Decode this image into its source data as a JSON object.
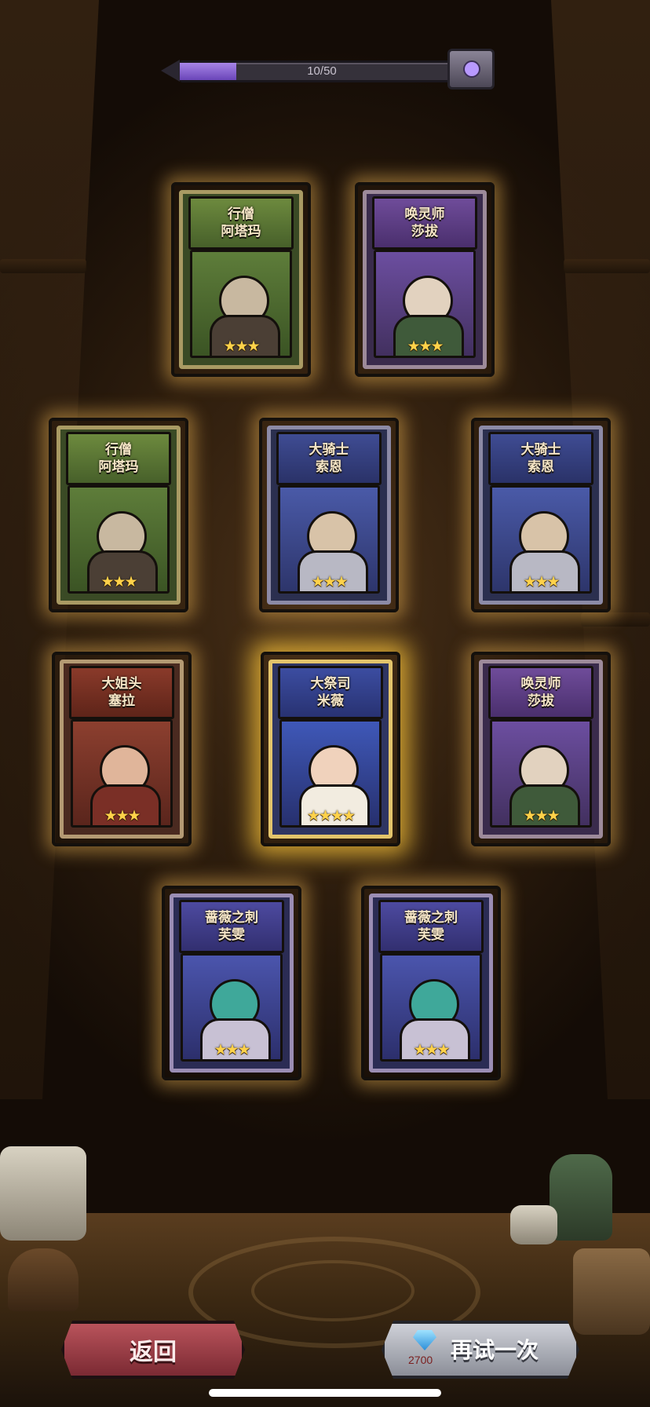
{
  "progress": {
    "label": "10/50",
    "value": 10,
    "max": 50
  },
  "cards": [
    {
      "title1": "行僧",
      "title2": "阿塔玛",
      "stars": "★★★",
      "theme": "green"
    },
    {
      "title1": "唤灵师",
      "title2": "莎拔",
      "stars": "★★★",
      "theme": "purple"
    },
    {
      "title1": "行僧",
      "title2": "阿塔玛",
      "stars": "★★★",
      "theme": "green"
    },
    {
      "title1": "大骑士",
      "title2": "索恩",
      "stars": "★★★",
      "theme": "blue"
    },
    {
      "title1": "大骑士",
      "title2": "索恩",
      "stars": "★★★",
      "theme": "blue"
    },
    {
      "title1": "大姐头",
      "title2": "塞拉",
      "stars": "★★★",
      "theme": "red"
    },
    {
      "title1": "大祭司",
      "title2": "米薇",
      "stars": "★★★★",
      "theme": "gold"
    },
    {
      "title1": "唤灵师",
      "title2": "莎拔",
      "stars": "★★★",
      "theme": "purple"
    },
    {
      "title1": "蔷薇之刺",
      "title2": "芙雯",
      "stars": "★★★",
      "theme": "teal"
    },
    {
      "title1": "蔷薇之刺",
      "title2": "芙雯",
      "stars": "★★★",
      "theme": "teal"
    }
  ],
  "buttons": {
    "back_label": "返回",
    "retry_label": "再试一次",
    "retry_cost": "2700",
    "retry_cost_icon": "diamond-icon"
  },
  "colors": {
    "progress_fill": "#8a66d6",
    "card_glow": "#ffc45a",
    "back_button": "#9c3a44",
    "retry_button": "#b4b7c0"
  }
}
